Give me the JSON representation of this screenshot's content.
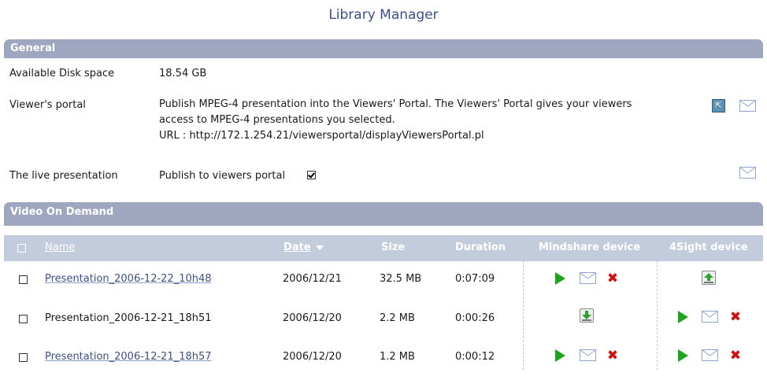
{
  "title": "Library Manager",
  "general": {
    "header": "General",
    "disk_label": "Available Disk space",
    "disk_value": "18.54 GB",
    "portal_label": "Viewer's portal",
    "portal_line1": "Publish MPEG-4 presentation into the Viewers' Portal. The Viewers' Portal gives your viewers",
    "portal_line2": "access to MPEG-4 presentations you selected.",
    "portal_url": "URL : http://172.1.254.21/viewersportal/displayViewersPortal.pl",
    "live_label": "The live presentation",
    "live_value": "Publish to viewers portal",
    "live_checked": true
  },
  "vod": {
    "header": "Video On Demand",
    "columns": {
      "name": "Name",
      "date": "Date",
      "size": "Size",
      "duration": "Duration",
      "mindshare": "Mindshare device",
      "foursight": "4Sight device"
    },
    "rows": [
      {
        "name": "Presentation_2006-12-22_10h48",
        "name_is_link": true,
        "date": "2006/12/21",
        "size": "32.5 MB",
        "duration": "0:07:09",
        "mindshare": [
          "play-icon",
          "envelope-icon",
          "delete-icon"
        ],
        "foursight": [
          "upload-icon"
        ]
      },
      {
        "name": "Presentation_2006-12-21_18h51",
        "name_is_link": false,
        "date": "2006/12/20",
        "size": "2.2 MB",
        "duration": "0:00:26",
        "mindshare": [
          "download-icon"
        ],
        "foursight": [
          "play-icon",
          "envelope-icon",
          "delete-icon"
        ]
      },
      {
        "name": "Presentation_2006-12-21_18h57",
        "name_is_link": true,
        "date": "2006/12/20",
        "size": "1.2 MB",
        "duration": "0:00:12",
        "mindshare": [
          "play-icon",
          "envelope-icon",
          "delete-icon"
        ],
        "foursight": [
          "play-icon",
          "envelope-icon",
          "delete-icon"
        ]
      }
    ]
  },
  "colors": {
    "title": "#3c4f86",
    "section_bar": "#9ea7bf",
    "table_header": "#c3ccdd",
    "link": "#3c4f86",
    "play": "#1ea51e",
    "delete": "#d01010"
  }
}
